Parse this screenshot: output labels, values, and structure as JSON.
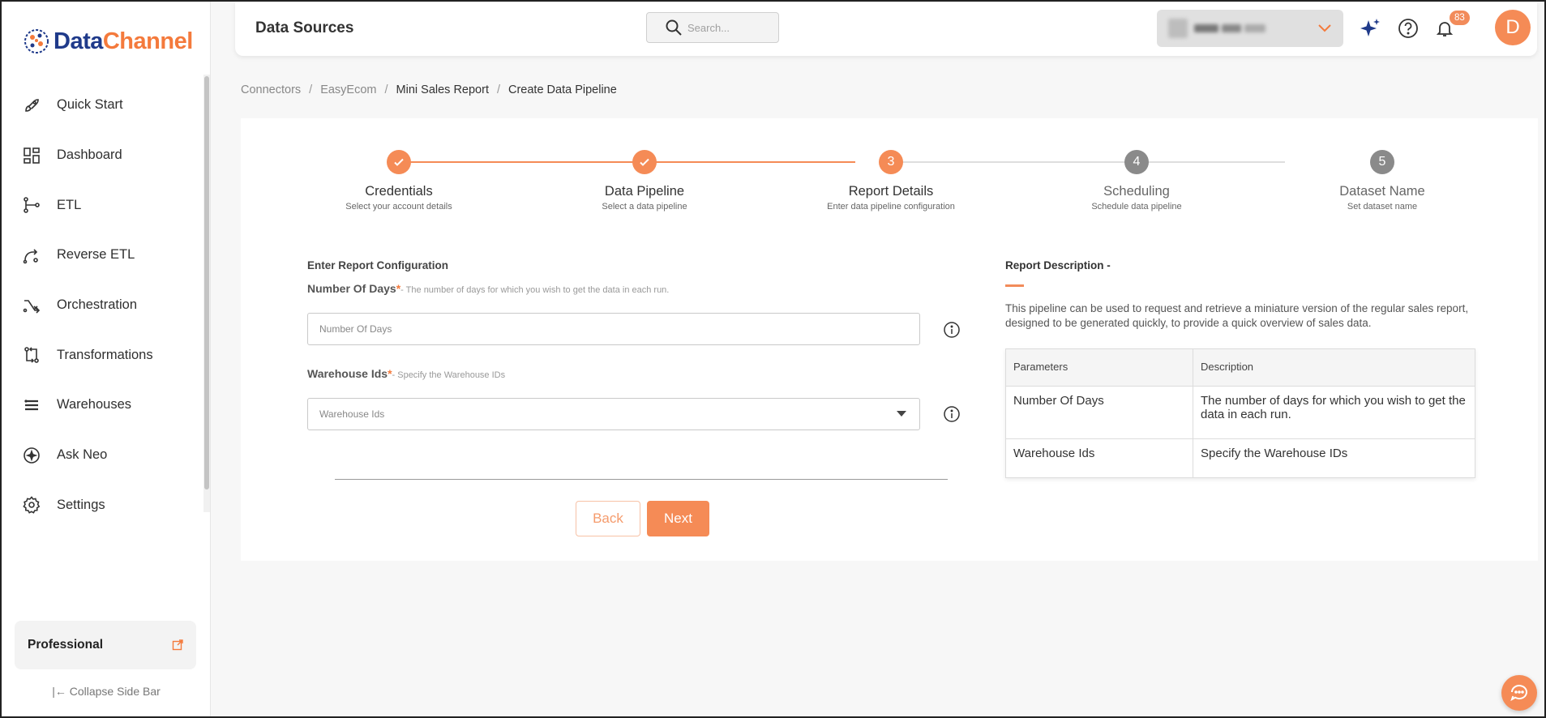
{
  "brand": {
    "logo_part1": "Data",
    "logo_part2": "Channel"
  },
  "sidebar": {
    "items": [
      {
        "label": "Quick Start",
        "icon": "rocket-icon"
      },
      {
        "label": "Dashboard",
        "icon": "dashboard-icon"
      },
      {
        "label": "ETL",
        "icon": "etl-icon"
      },
      {
        "label": "Reverse ETL",
        "icon": "reverse-etl-icon"
      },
      {
        "label": "Orchestration",
        "icon": "orchestration-icon"
      },
      {
        "label": "Transformations",
        "icon": "transformations-icon"
      },
      {
        "label": "Warehouses",
        "icon": "warehouses-icon"
      },
      {
        "label": "Ask Neo",
        "icon": "sparkle-icon"
      },
      {
        "label": "Settings",
        "icon": "gear-icon"
      }
    ],
    "plan": "Professional",
    "collapse_label": "Collapse Side Bar"
  },
  "header": {
    "title": "Data Sources",
    "search_placeholder": "Search...",
    "notification_count": "83",
    "avatar_letter": "D"
  },
  "breadcrumb": [
    "Connectors",
    "EasyEcom",
    "Mini Sales Report",
    "Create Data Pipeline"
  ],
  "stepper": [
    {
      "number": "1",
      "title": "Credentials",
      "subtitle": "Select your account details",
      "state": "done"
    },
    {
      "number": "2",
      "title": "Data Pipeline",
      "subtitle": "Select a data pipeline",
      "state": "done"
    },
    {
      "number": "3",
      "title": "Report Details",
      "subtitle": "Enter data pipeline configuration",
      "state": "active"
    },
    {
      "number": "4",
      "title": "Scheduling",
      "subtitle": "Schedule data pipeline",
      "state": "pending"
    },
    {
      "number": "5",
      "title": "Dataset Name",
      "subtitle": "Set dataset name",
      "state": "pending"
    }
  ],
  "form": {
    "section_title": "Enter Report Configuration",
    "days": {
      "label": "Number Of Days",
      "required": "*",
      "hint": "- The number of days for which you wish to get the data in each run.",
      "placeholder": "Number Of Days"
    },
    "warehouse": {
      "label": "Warehouse Ids",
      "required": "*",
      "hint": "- Specify the Warehouse IDs",
      "placeholder": "Warehouse Ids"
    },
    "back_label": "Back",
    "next_label": "Next"
  },
  "description": {
    "title": "Report Description -",
    "text": "This pipeline can be used to request and retrieve a miniature version of the regular sales report, designed to be generated quickly, to provide a quick overview of sales data.",
    "table": {
      "headers": [
        "Parameters",
        "Description"
      ],
      "rows": [
        [
          "Number Of Days",
          "The number of days for which you wish to get the data in each run."
        ],
        [
          "Warehouse Ids",
          "Specify the Warehouse IDs"
        ]
      ]
    }
  },
  "colors": {
    "accent": "#f58b56",
    "pending": "#8a8a8a",
    "brand_blue": "#1f3a8a"
  }
}
